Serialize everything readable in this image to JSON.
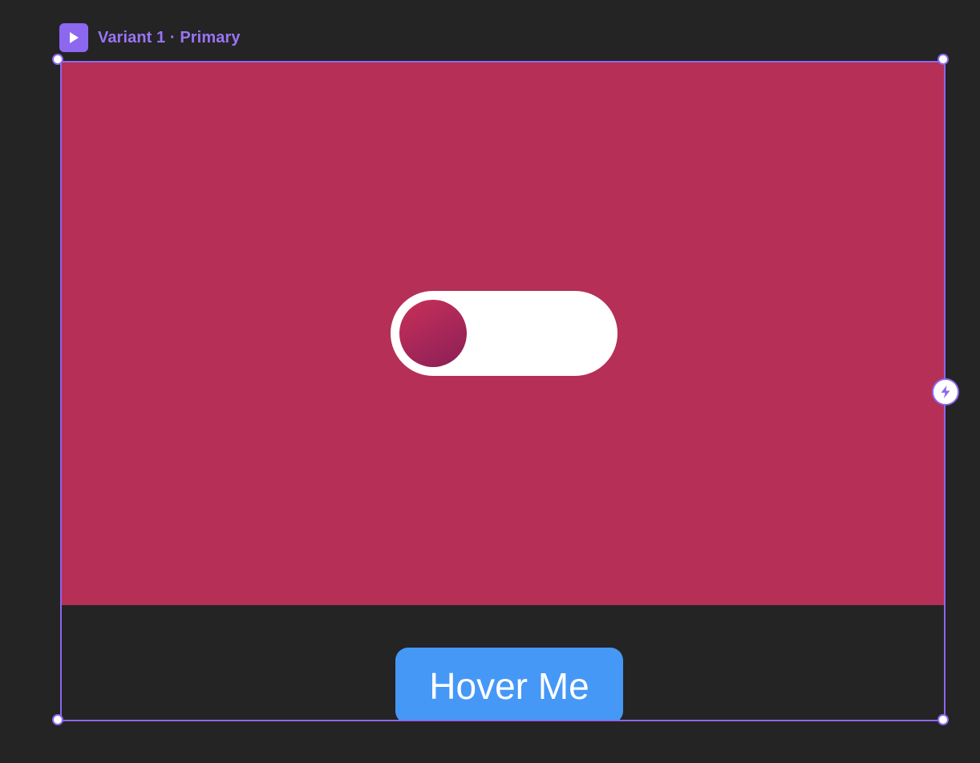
{
  "variant": {
    "label": "Variant 1 · Primary",
    "icon": "play-icon"
  },
  "frame": {
    "hero_color": "#b52f57",
    "border_color": "#8c67f0"
  },
  "toggle": {
    "state": "off",
    "track_color": "#ffffff",
    "knob_gradient": [
      "#c93058",
      "#8a1f57"
    ]
  },
  "button": {
    "label": "Hover Me",
    "color": "#4698f7",
    "text_color": "#ffffff"
  },
  "accent": {
    "purple": "#8c67f0",
    "label_purple": "#9a74f5"
  },
  "interaction": {
    "icon": "lightning-icon"
  }
}
